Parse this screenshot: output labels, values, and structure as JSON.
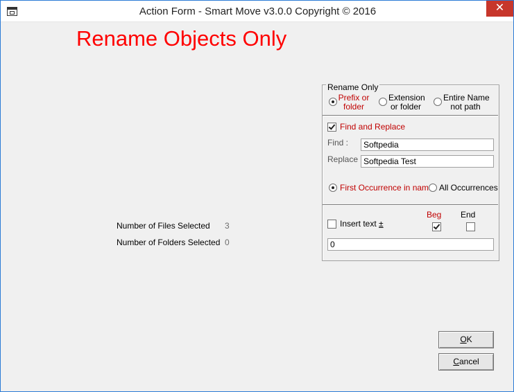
{
  "window": {
    "title": "Action Form - Smart Move v3.0.0 Copyright © 2016",
    "close_glyph": "✕"
  },
  "heading": "Rename Objects Only",
  "stats": {
    "files_label": "Number of Files Selected",
    "files_value": "3",
    "folders_label": "Number of Folders Selected",
    "folders_value": "0"
  },
  "rename_group": {
    "legend": "Rename Only",
    "options": [
      {
        "line1": "Prefix or",
        "line2": "folder",
        "selected": true
      },
      {
        "line1": "Extension",
        "line2": "or folder",
        "selected": false
      },
      {
        "line1": "Entire Name",
        "line2": "not path",
        "selected": false
      }
    ]
  },
  "find_replace": {
    "checkbox_label": "Find and Replace",
    "checked": true,
    "find_label": "Find :",
    "find_value": "Softpedia",
    "replace_label": "Replace :",
    "replace_value": "Softpedia Test",
    "first_label": "First Occurrence in name",
    "all_label": "All Occurrences",
    "mode": "first"
  },
  "insert": {
    "checkbox_label": "Insert text",
    "plus_minus": "±",
    "checked": false,
    "beg_label": "Beg",
    "beg_checked": true,
    "end_label": "End",
    "end_checked": false,
    "value": "0"
  },
  "buttons": {
    "ok_prefix": "",
    "ok_accel": "O",
    "ok_rest": "K",
    "cancel_accel": "C",
    "cancel_rest": "ancel"
  },
  "colors": {
    "accent_red": "#ff0000",
    "label_red": "#c00000",
    "close_red": "#c7362b"
  },
  "icons": {
    "app": "form-window-icon",
    "close": "close-icon"
  }
}
